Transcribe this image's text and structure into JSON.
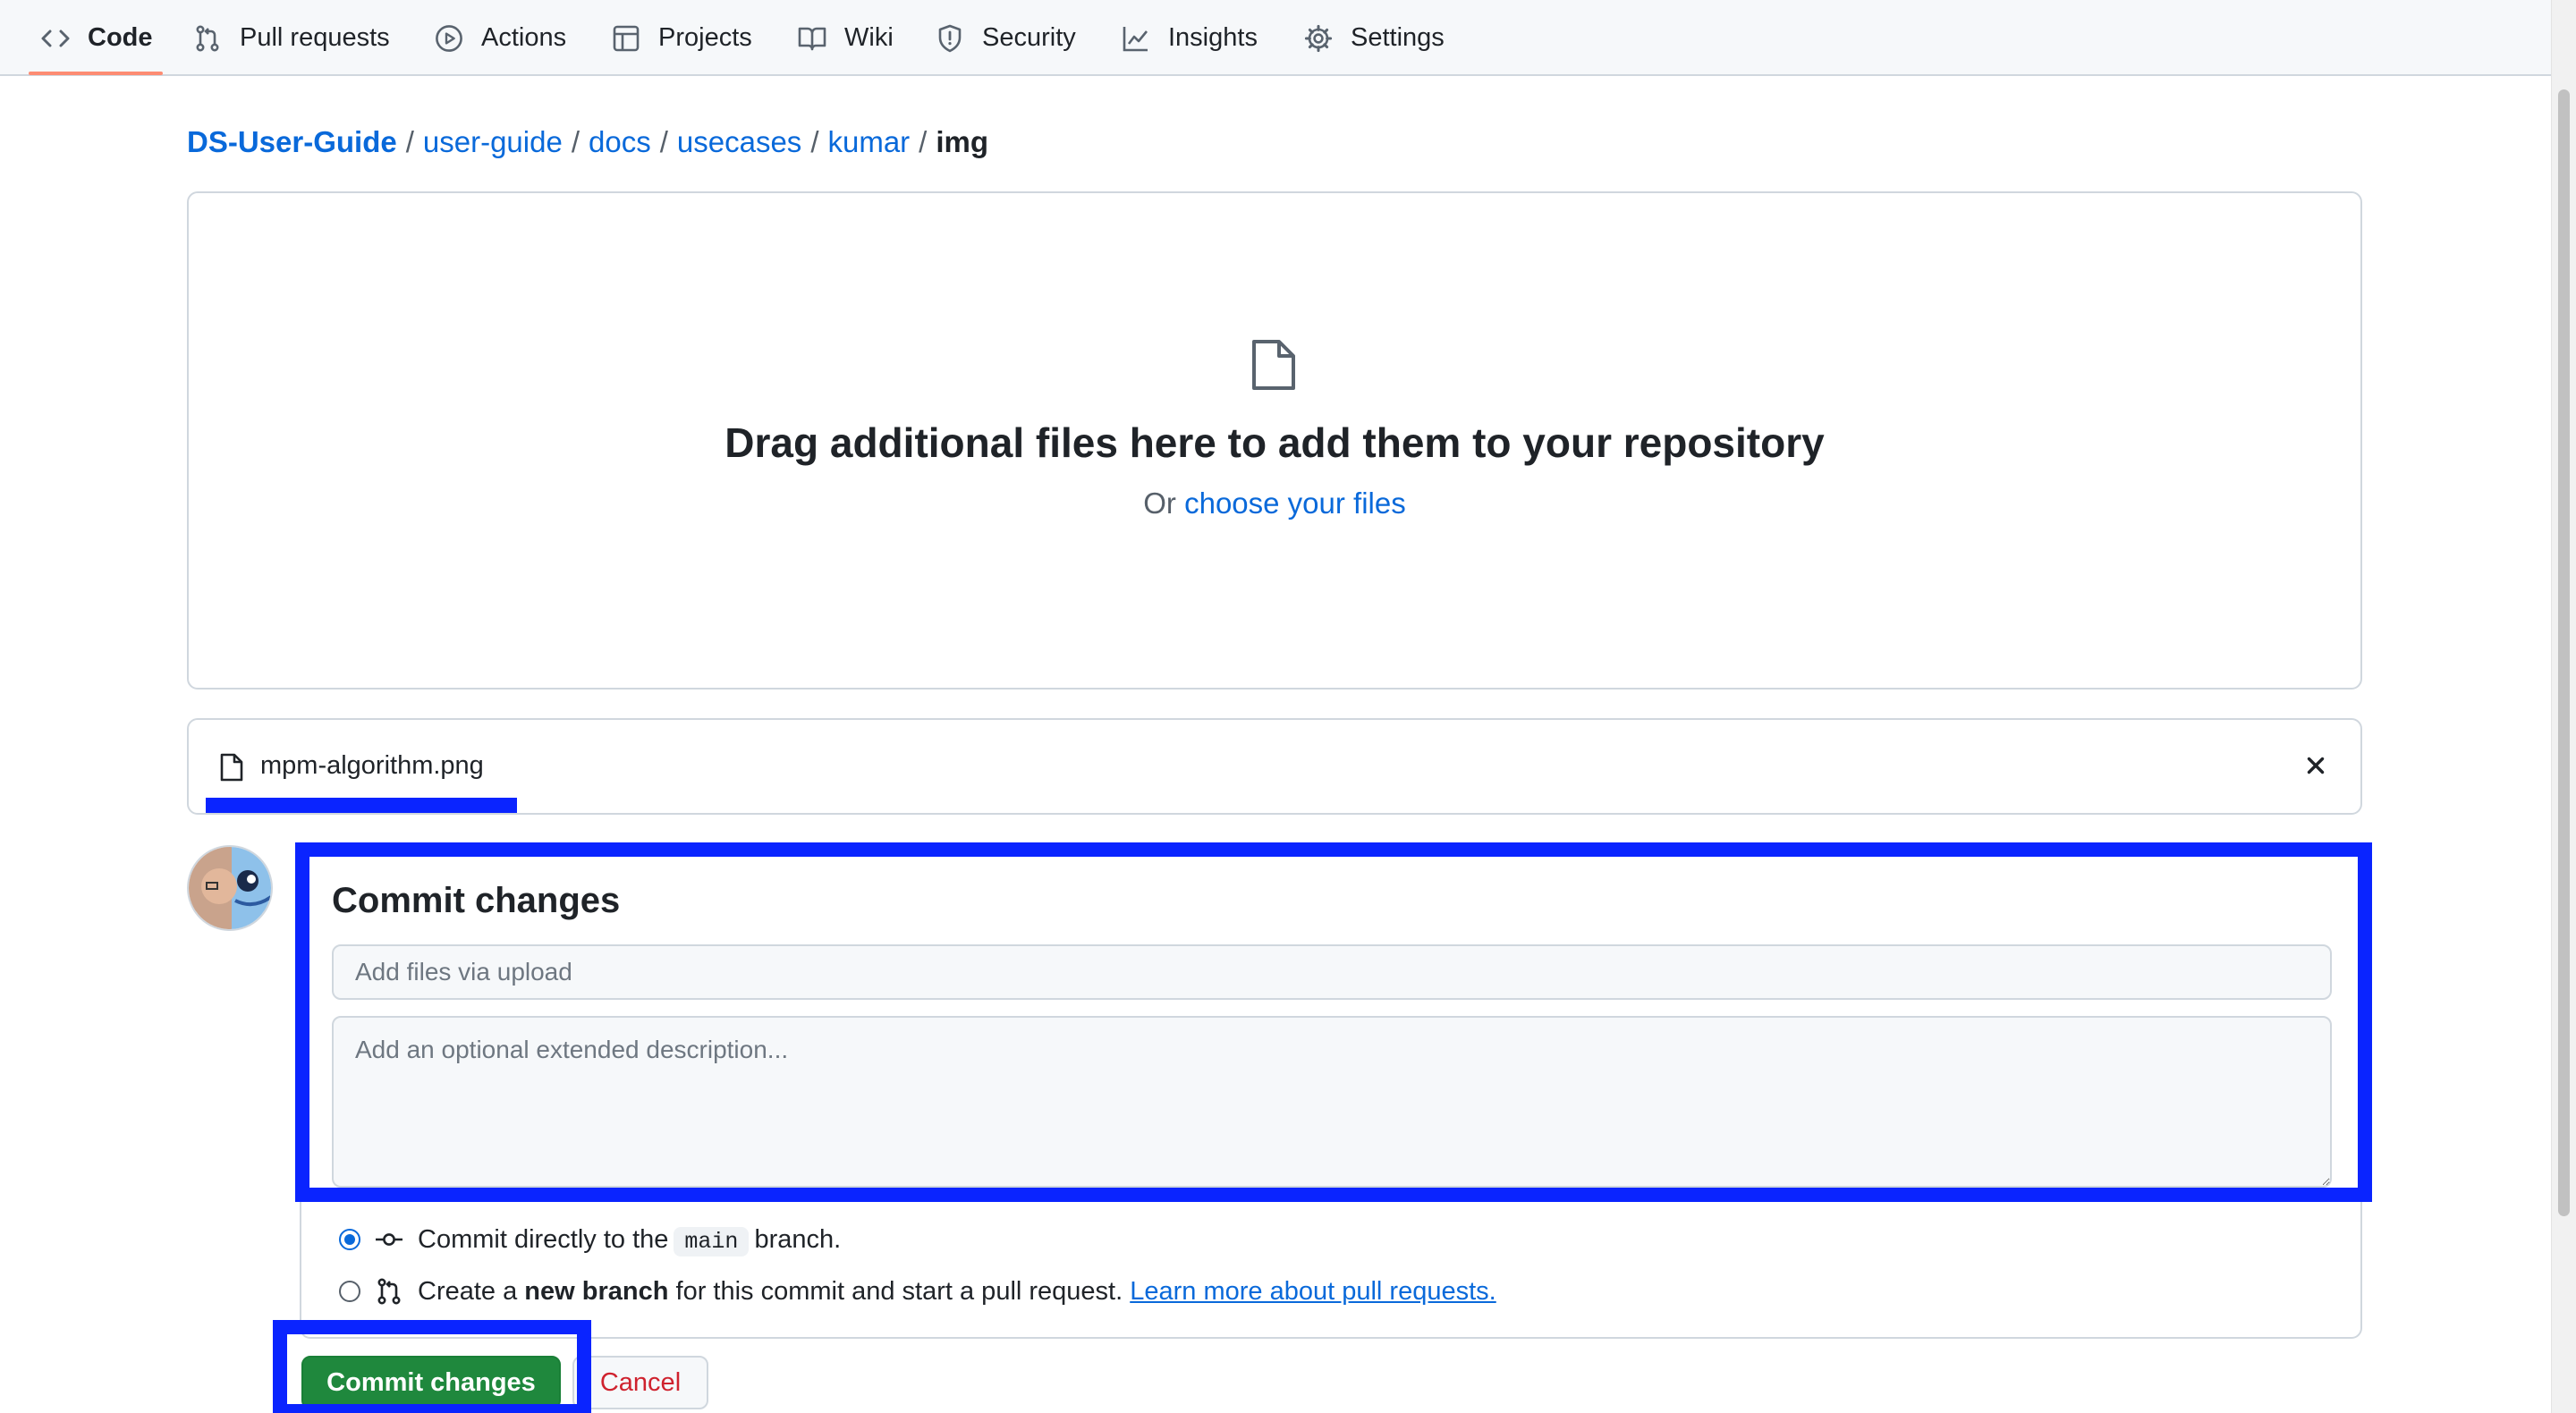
{
  "nav": {
    "items": [
      {
        "label": "Code",
        "icon": "code-icon",
        "active": true
      },
      {
        "label": "Pull requests",
        "icon": "git-pull-request-icon"
      },
      {
        "label": "Actions",
        "icon": "play-icon"
      },
      {
        "label": "Projects",
        "icon": "table-icon"
      },
      {
        "label": "Wiki",
        "icon": "book-icon"
      },
      {
        "label": "Security",
        "icon": "shield-icon"
      },
      {
        "label": "Insights",
        "icon": "graph-icon"
      },
      {
        "label": "Settings",
        "icon": "gear-icon"
      }
    ]
  },
  "breadcrumb": {
    "root": "DS-User-Guide",
    "parts": [
      "user-guide",
      "docs",
      "usecases",
      "kumar"
    ],
    "current": "img",
    "separator": "/"
  },
  "dropzone": {
    "title": "Drag additional files here to add them to your repository",
    "prefix": "Or",
    "link": "choose your files"
  },
  "file": {
    "name": "mpm-algorithm.png"
  },
  "commit": {
    "title": "Commit changes",
    "summary_placeholder": "Add files via upload",
    "description_placeholder": "Add an optional extended description...",
    "option_direct": {
      "prefix": "Commit directly to the",
      "branch": "main",
      "suffix": "branch."
    },
    "option_new": {
      "prefix": "Create a",
      "bold": "new branch",
      "suffix": "for this commit and start a pull request.",
      "link": "Learn more about pull requests."
    },
    "submit_label": "Commit changes",
    "cancel_label": "Cancel"
  },
  "colors": {
    "accent": "#0969da",
    "primary_button": "#1f883d",
    "cancel_text": "#cf222e",
    "annotation": "#0a24ff",
    "tab_underline": "#fd8c73"
  }
}
